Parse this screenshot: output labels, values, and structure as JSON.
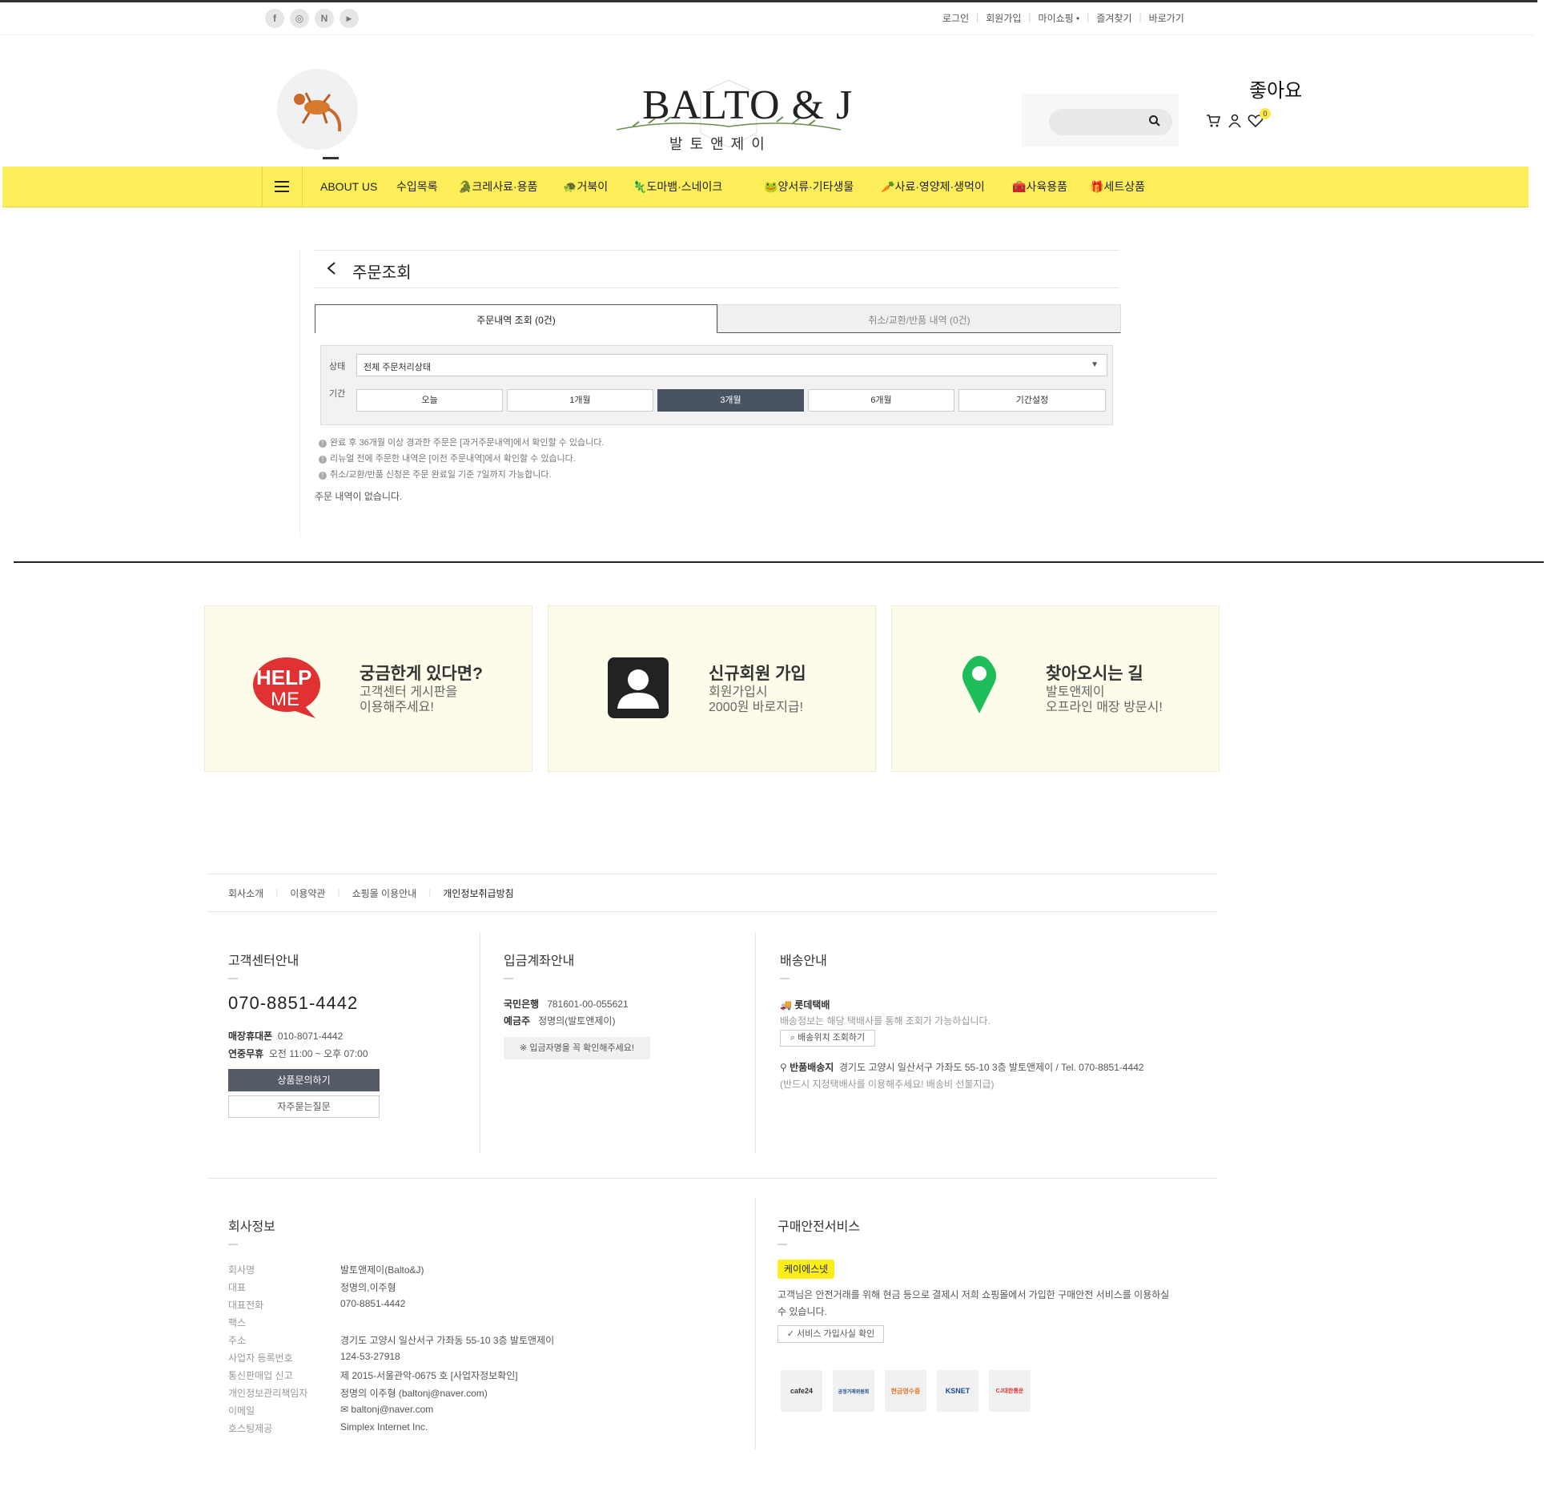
{
  "header": {
    "social": [
      {
        "icon": "facebook-icon",
        "glyph": "f"
      },
      {
        "icon": "instagram-icon",
        "glyph": "◎"
      },
      {
        "icon": "naver-icon",
        "glyph": "N"
      },
      {
        "icon": "youtube-icon",
        "glyph": "▶"
      }
    ],
    "top_links": [
      "로그인",
      "회원가입",
      "마이쇼핑 •",
      "즐겨찾기",
      "바로가기"
    ],
    "logo_main": "BALTO & J",
    "logo_sub": "발 토 앤 제 이",
    "like_text": "좋아요",
    "wishlist_count": "0"
  },
  "nav": {
    "items": [
      "ABOUT US",
      "수입목록",
      "크레사료·용품",
      "거북이",
      "도마뱀·스네이크",
      "양서류·기타생물",
      "사료·영양제·생먹이",
      "사육용품",
      "세트상품"
    ]
  },
  "order": {
    "title": "주문조회",
    "tab_active": "주문내역 조회 (0건)",
    "tab_inactive": "취소/교환/반품 내역 (0건)",
    "status_label": "상태",
    "status_value": "전체 주문처리상태",
    "period_label": "기간",
    "periods": [
      "오늘",
      "1개월",
      "3개월",
      "6개월",
      "기간설정"
    ],
    "notice1": "완료 후 36개월 이상 경과한 주문은 [과거주문내역]에서 확인할 수 있습니다.",
    "notice2": "리뉴얼 전에 주문한 내역은 [이전 주문내역]에서 확인할 수 있습니다.",
    "notice3": "취소/교환/반품 신청은 주문 완료일 기준 7일까지 가능합니다.",
    "empty": "주문 내역이 없습니다."
  },
  "cards": [
    {
      "title": "궁금한게 있다면?",
      "line1": "고객센터 게시판을",
      "line2": "이용해주세요!",
      "icon": "help-me-icon"
    },
    {
      "title": "신규회원 가입",
      "line1": "회원가입시",
      "line2": "2000원 바로지급!",
      "icon": "user-card-icon"
    },
    {
      "title": "찾아오시는 길",
      "line1": "발토앤제이",
      "line2": "오프라인 매장 방문시!",
      "icon": "map-pin-icon"
    }
  ],
  "footer": {
    "links": [
      "회사소개",
      "이용약관",
      "쇼핑몰 이용안내",
      "개인정보취급방침"
    ],
    "cs": {
      "title": "고객센터안내",
      "dash": "—",
      "phone": "070-8851-4442",
      "mobile_label": "매장휴대폰",
      "mobile": "010-8071-4442",
      "hours_label": "연중무휴",
      "hours": "오전 11:00 ~ 오후 07:00",
      "btn_inquiry": "상품문의하기",
      "btn_faq": "자주묻는질문"
    },
    "bank": {
      "title": "입금계좌안내",
      "bank_label": "국민은행",
      "account": "781601-00-055621",
      "holder_label": "예금주",
      "holder": "정명의(발토앤제이)",
      "note": "※ 입금자명을 꼭 확인해주세요!"
    },
    "delivery": {
      "title": "배송안내",
      "courier": "롯데택배",
      "courier_desc": "배송정보는 해당 택배사를 통해 조회가 가능하십니다.",
      "track_btn": "배송위치 조회하기",
      "return_label": "반품배송지",
      "return_addr": "경기도 고양시 일산서구 가좌도 55-10 3층 발토앤제이 / Tel. 070-8851-4442",
      "return_note": "(반드시 지정택배사를 이용해주세요! 배송비 선불지급)"
    },
    "company": {
      "title": "회사정보",
      "rows": [
        {
          "k": "회사명",
          "v": "발토앤제이(Balto&J)"
        },
        {
          "k": "대표",
          "v": "정명의,이주형"
        },
        {
          "k": "대표전화",
          "v": "070-8851-4442"
        },
        {
          "k": "팩스",
          "v": ""
        },
        {
          "k": "주소",
          "v": "경기도 고양시 일산서구 가좌동 55-10 3층 발토앤제이"
        },
        {
          "k": "사업자 등록번호",
          "v": "124-53-27918"
        },
        {
          "k": "통신판매업 신고",
          "v": "제 2015-서울관악-0675 호  [사업자정보확인]"
        },
        {
          "k": "개인정보관리책임자",
          "v": "정명의 이주형 (baltonj@naver.com)"
        },
        {
          "k": "이메일",
          "v": "✉ baltonj@naver.com"
        },
        {
          "k": "호스팅제공",
          "v": "Simplex Internet Inc."
        }
      ]
    },
    "safe": {
      "title": "구매안전서비스",
      "badge": "케이에스넷",
      "desc1": "고객님은 안전거래를 위해 현금 등으로 결제시 저희 쇼핑몰에서 가입한 구매안전 서비스를 이용하실",
      "desc2": "수 있습니다.",
      "check_btn": "서비스 가입사실 확인",
      "logos": [
        "cafe24",
        "공정거래위원회",
        "현금영수증",
        "KSNET",
        "CJ대한통운"
      ]
    }
  }
}
